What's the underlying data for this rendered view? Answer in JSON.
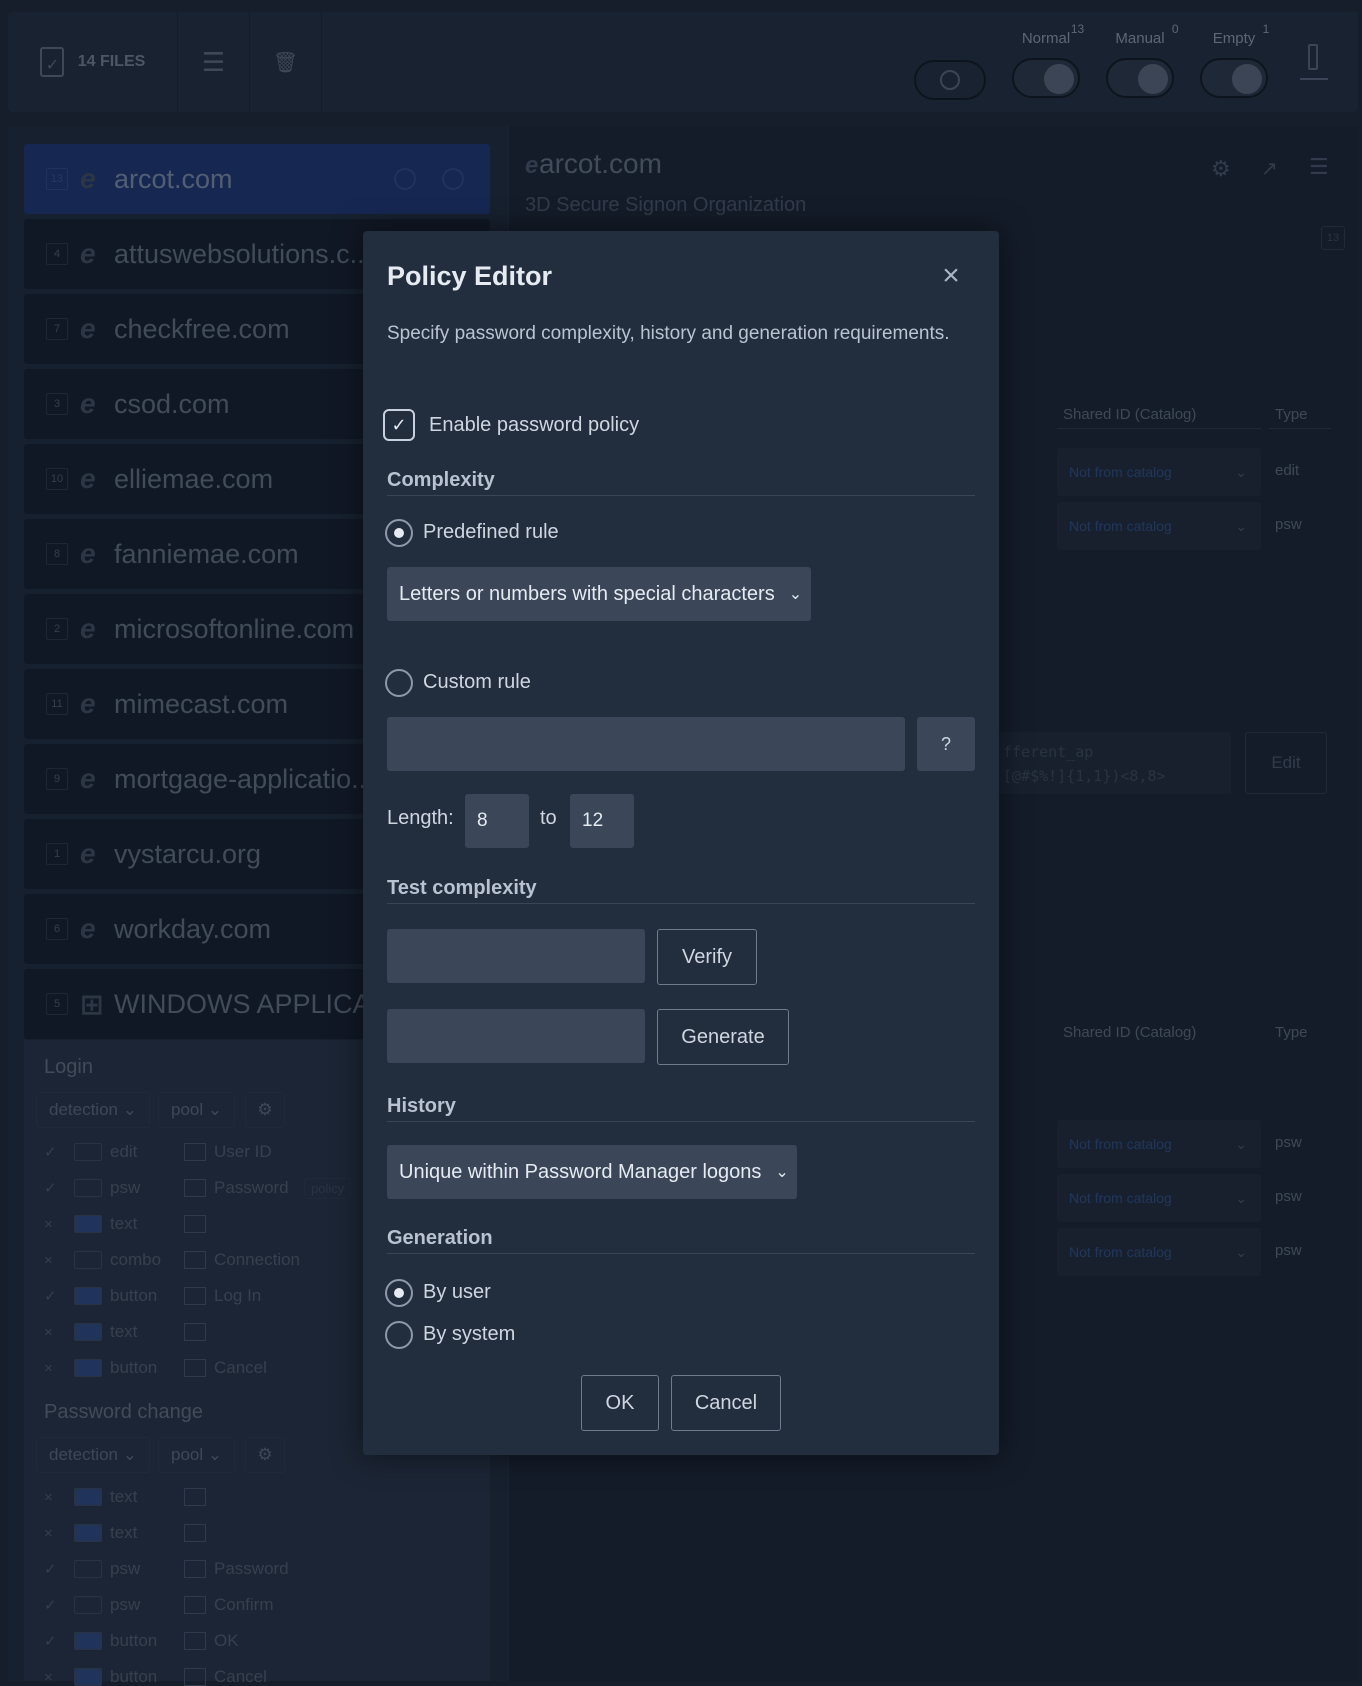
{
  "topbar": {
    "files_label": "14 FILES",
    "toggles": [
      {
        "label": "Normal",
        "count": "13"
      },
      {
        "label": "Manual",
        "count": "0"
      },
      {
        "label": "Empty",
        "count": "1"
      }
    ]
  },
  "sites": [
    {
      "num": "13",
      "name": "arcot.com"
    },
    {
      "num": "4",
      "name": "attuswebsolutions.c..."
    },
    {
      "num": "7",
      "name": "checkfree.com"
    },
    {
      "num": "3",
      "name": "csod.com"
    },
    {
      "num": "10",
      "name": "elliemae.com"
    },
    {
      "num": "8",
      "name": "fanniemae.com"
    },
    {
      "num": "2",
      "name": "microsoftonline.com"
    },
    {
      "num": "11",
      "name": "mimecast.com"
    },
    {
      "num": "9",
      "name": "mortgage-applicatio..."
    },
    {
      "num": "1",
      "name": "vystarcu.org"
    },
    {
      "num": "6",
      "name": "workday.com"
    },
    {
      "num": "5",
      "name": "WINDOWS APPLICAT..."
    }
  ],
  "login": {
    "title": "Login",
    "detection": "detection",
    "pool": "pool",
    "rows": [
      {
        "check": "✓",
        "type": "edit",
        "label": "User ID"
      },
      {
        "check": "✓",
        "type": "psw",
        "label": "Password",
        "chip": "policy"
      },
      {
        "check": "×",
        "type": "text",
        "label": ""
      },
      {
        "check": "×",
        "type": "combo",
        "label": "Connection"
      },
      {
        "check": "✓",
        "type": "button",
        "label": "Log In"
      },
      {
        "check": "×",
        "type": "text",
        "label": ""
      },
      {
        "check": "×",
        "type": "button",
        "label": "Cancel"
      }
    ]
  },
  "pwchange": {
    "title": "Password change",
    "detection": "detection",
    "pool": "pool",
    "rows": [
      {
        "check": "×",
        "type": "text",
        "label": ""
      },
      {
        "check": "×",
        "type": "text",
        "label": ""
      },
      {
        "check": "✓",
        "type": "psw",
        "label": "Password"
      },
      {
        "check": "✓",
        "type": "psw",
        "label": "Confirm"
      },
      {
        "check": "✓",
        "type": "button",
        "label": "OK"
      },
      {
        "check": "×",
        "type": "button",
        "label": "Cancel"
      }
    ]
  },
  "right": {
    "title": "arcot.com",
    "subtitle": "3D Secure Signon Organization",
    "badge": "13",
    "col_shared": "Shared ID (Catalog)",
    "col_type": "Type",
    "not_from_catalog": "Not from catalog",
    "type_edit": "edit",
    "type_psw": "psw",
    "code_line1": "fferent_ap",
    "code_line2": "[@#$%!]{1,1})<8,8>",
    "edit_button": "Edit"
  },
  "modal": {
    "title": "Policy Editor",
    "description": "Specify password complexity, history and generation requirements.",
    "enable_label": "Enable password policy",
    "complexity_title": "Complexity",
    "predefined_label": "Predefined rule",
    "predefined_value": "Letters or numbers with special characters",
    "custom_label": "Custom rule",
    "custom_value": "",
    "help_label": "?",
    "length_label": "Length:",
    "length_min": "8",
    "length_to": "to",
    "length_max": "12",
    "test_title": "Test complexity",
    "verify_label": "Verify",
    "generate_label": "Generate",
    "history_title": "History",
    "history_value": "Unique within Password Manager logons",
    "generation_title": "Generation",
    "by_user_label": "By user",
    "by_system_label": "By system",
    "ok_label": "OK",
    "cancel_label": "Cancel"
  }
}
